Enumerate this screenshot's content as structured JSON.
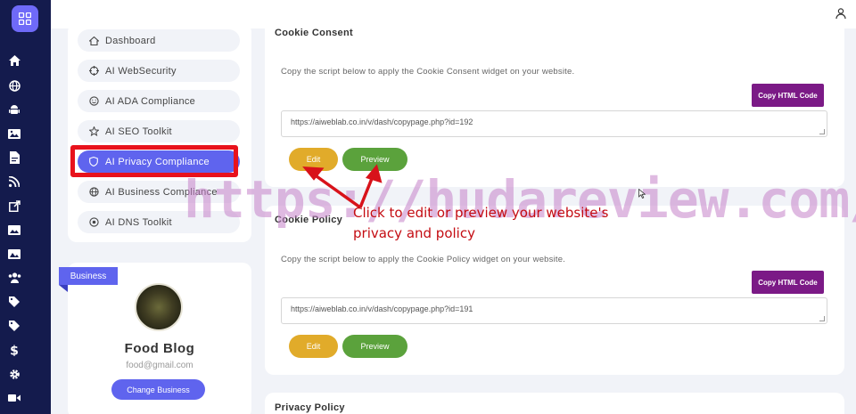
{
  "sidebar": {
    "icons": [
      "apps-grid-icon",
      "home-icon",
      "globe-icon",
      "android-icon",
      "image-icon",
      "document-icon",
      "rss-icon",
      "external-link-icon",
      "gallery-icon",
      "picture-icon",
      "users-icon",
      "tag-icon",
      "tags-icon",
      "dollar-icon",
      "gear-icon",
      "video-icon"
    ]
  },
  "nav": {
    "items": [
      {
        "label": "Dashboard",
        "icon": "home-icon"
      },
      {
        "label": "AI WebSecurity",
        "icon": "crosshair-icon"
      },
      {
        "label": "AI ADA Compliance",
        "icon": "smile-icon"
      },
      {
        "label": "AI SEO Toolkit",
        "icon": "star-icon"
      },
      {
        "label": "AI Privacy Compliance",
        "icon": "shield-icon"
      },
      {
        "label": "AI Business Compliance",
        "icon": "globe-icon"
      },
      {
        "label": "AI DNS Toolkit",
        "icon": "target-icon"
      }
    ],
    "active_index": 4
  },
  "profile": {
    "badge": "Business",
    "name": "Food Blog",
    "email": "food@gmail.com",
    "button": "Change Business"
  },
  "sections": [
    {
      "title": "Cookie Consent",
      "description": "Copy the script below to apply the Cookie Consent widget on your website.",
      "copy_button": "Copy HTML Code",
      "url": "https://aiweblab.co.in/v/dash/copypage.php?id=192",
      "edit_button": "Edit",
      "preview_button": "Preview"
    },
    {
      "title": "Cookie Policy",
      "description": "Copy the script below to apply the Cookie Policy widget on your website.",
      "copy_button": "Copy HTML Code",
      "url": "https://aiweblab.co.in/v/dash/copypage.php?id=191",
      "edit_button": "Edit",
      "preview_button": "Preview"
    },
    {
      "title": "Privacy Policy"
    }
  ],
  "overlay": {
    "watermark": "https://hudareview.com/",
    "annotation_line1": "Click to edit or preview your website's",
    "annotation_line2": "privacy and policy"
  },
  "colors": {
    "rail": "#141b4d",
    "accent": "#5f64ee",
    "copy_button": "#7b1a86",
    "edit_button": "#e1ab2a",
    "preview_button": "#5ba23c",
    "highlight": "#e8121c"
  }
}
